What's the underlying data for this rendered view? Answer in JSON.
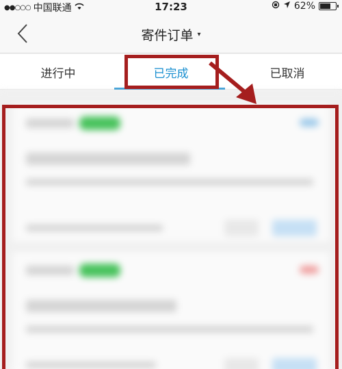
{
  "status_bar": {
    "signal": "●●○○○",
    "carrier": "中国联通",
    "wifi": "wifi-icon",
    "time": "17:23",
    "battery_percent": "62%",
    "battery_level": 0.62
  },
  "nav": {
    "back_icon": "chevron-left-icon",
    "title": "寄件订单",
    "title_caret": "▾"
  },
  "tabs": [
    {
      "label": "进行中",
      "active": false
    },
    {
      "label": "已完成",
      "active": true
    },
    {
      "label": "已取消",
      "active": false
    }
  ],
  "colors": {
    "accent": "#1a8fd0",
    "highlight": "#a51e1e"
  }
}
